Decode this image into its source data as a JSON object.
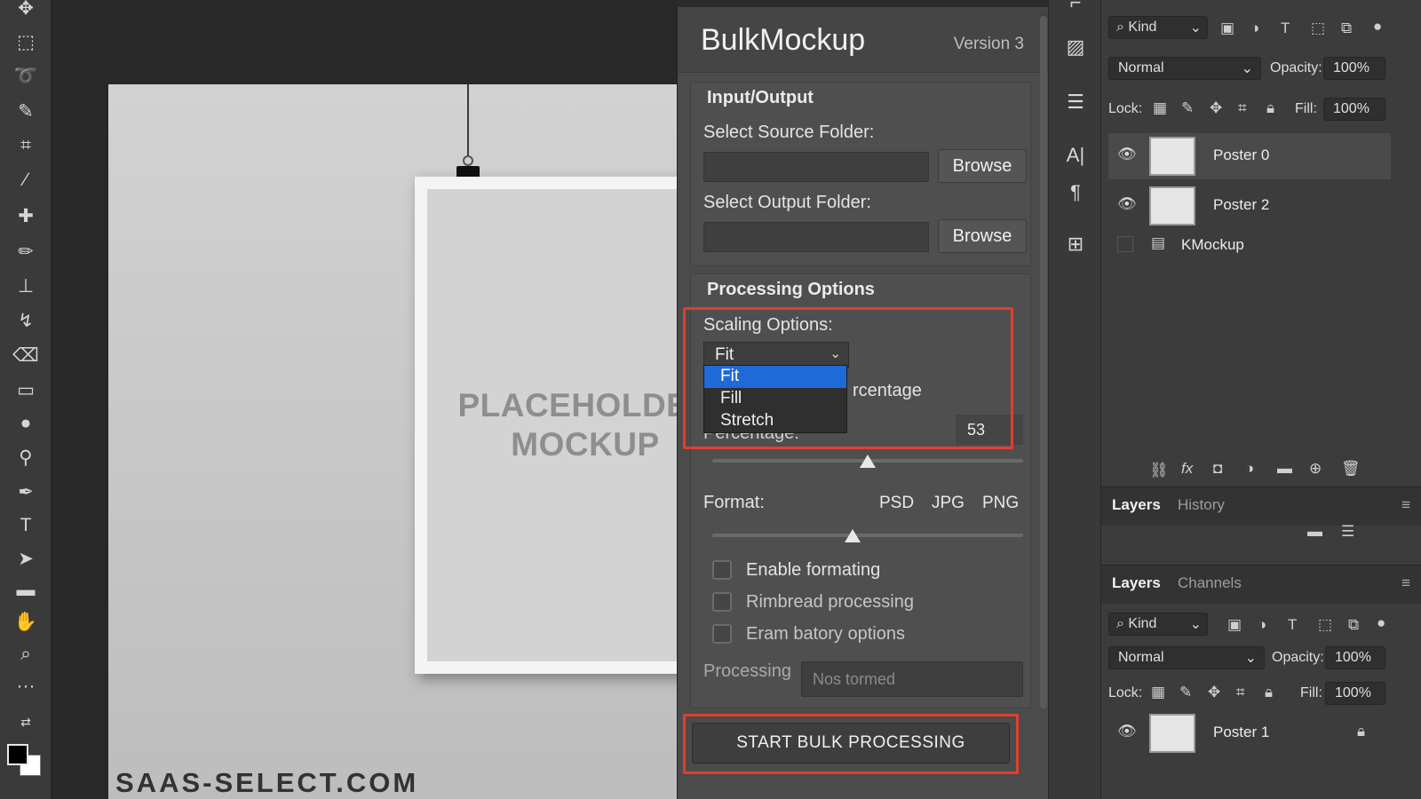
{
  "plugin": {
    "title": "BulkMockup",
    "version": "Version 3",
    "input_output": {
      "title": "Input/Output",
      "source_label": "Select Source Folder:",
      "source_value": "",
      "output_label": "Select Output Folder:",
      "output_value": "",
      "browse_label": "Browse"
    },
    "processing_options": {
      "title": "Processing Options",
      "scaling_label": "Scaling Options:",
      "scaling_selected": "Fit",
      "scaling_options": [
        "Fit",
        "Fill",
        "Stretch"
      ],
      "hidden_partial_label": "rcentage",
      "percentage_label": "Percentage:",
      "percentage_value": "53",
      "percentage_slider_level": 0.5,
      "format_label": "Format:",
      "format_options": [
        "PSD",
        "JPG",
        "PNG"
      ],
      "format_slider_level": 0.45,
      "checkboxes": [
        {
          "label": "Enable formating",
          "checked": false
        },
        {
          "label": "Rimbread processing",
          "checked": false
        },
        {
          "label": "Eram batory options",
          "checked": false
        }
      ],
      "processing_label": "Processing",
      "processing_status": "Nos tormed"
    },
    "start_button": "START BULK PROCESSING"
  },
  "canvas": {
    "placeholder_line1": "PLACEHOLDER",
    "placeholder_line2": "MOCKUP",
    "watermark": "SAAS-SELECT.COM"
  },
  "layers_panel_top": {
    "kind": "Kind",
    "blend_mode": "Normal",
    "opacity_label": "Opacity:",
    "opacity_value": "100%",
    "lock_label": "Lock:",
    "fill_label": "Fill:",
    "fill_value": "100%",
    "layers": [
      {
        "name": "Poster 0",
        "visible": true,
        "active": true
      },
      {
        "name": "Poster 2",
        "visible": true,
        "active": false
      },
      {
        "name": "KMockup",
        "visible": false,
        "active": false
      }
    ]
  },
  "tabs_1": {
    "active": "Layers",
    "other": "History"
  },
  "tabs_2": {
    "active": "Layers",
    "other": "Channels"
  },
  "layers_panel_bottom": {
    "kind": "Kind",
    "blend_mode": "Normal",
    "opacity_label": "Opacity:",
    "opacity_value": "100%",
    "lock_label": "Lock:",
    "fill_label": "Fill:",
    "fill_value": "100%",
    "layers": [
      {
        "name": "Poster 1",
        "visible": true,
        "locked": true
      }
    ]
  },
  "colors": {
    "highlight": "#e43e2b",
    "selection": "#1f6ad8",
    "panel_bg": "#4b4b4b"
  }
}
